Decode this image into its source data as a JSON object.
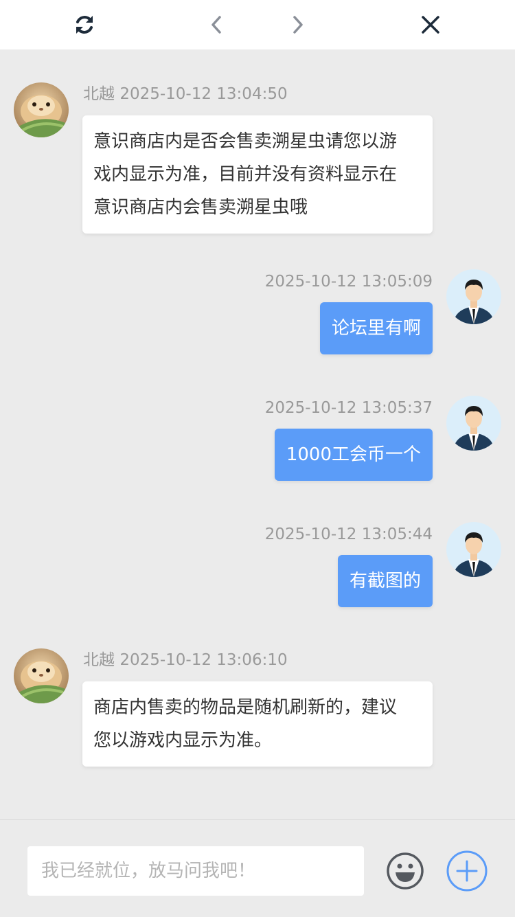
{
  "colors": {
    "accent": "#5b9cf8",
    "background": "#ebebeb",
    "topbar": "#ffffff",
    "icon_dark": "#1d2b3a",
    "icon_grey": "#8a8f98",
    "meta_text": "#999999"
  },
  "topbar": {
    "refresh_icon": "refresh-icon",
    "back_icon": "chevron-left-icon",
    "forward_icon": "chevron-right-icon",
    "close_icon": "close-icon"
  },
  "messages": [
    {
      "direction": "in",
      "sender": "北越",
      "time": "2025-10-12 13:04:50",
      "lines": [
        "意识商店内是否会售卖溯星虫请您以游",
        "戏内显示为准，目前并没有资料显示在",
        "意识商店内会售卖溯星虫哦"
      ]
    },
    {
      "direction": "out",
      "time": "2025-10-12 13:05:09",
      "text": "论坛里有啊"
    },
    {
      "direction": "out",
      "time": "2025-10-12 13:05:37",
      "text": "1000工会币一个"
    },
    {
      "direction": "out",
      "time": "2025-10-12 13:05:44",
      "text": "有截图的"
    },
    {
      "direction": "in",
      "sender": "北越",
      "time": "2025-10-12 13:06:10",
      "lines": [
        "商店内售卖的物品是随机刷新的，建议",
        "您以游戏内显示为准。"
      ]
    }
  ],
  "composer": {
    "placeholder": "我已经就位，放马问我吧！",
    "emoji_icon": "emoji-icon",
    "plus_icon": "plus-circle-icon"
  }
}
